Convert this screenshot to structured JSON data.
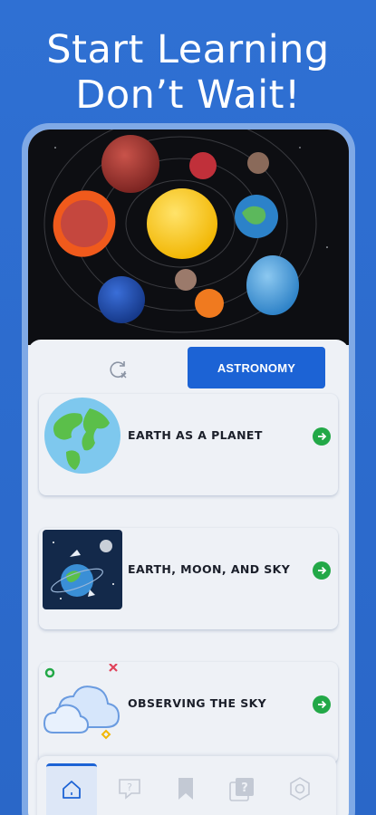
{
  "headline": {
    "line1": "Start Learning",
    "line2": "Don’t Wait!"
  },
  "hero": {
    "icon": "solar-system-image"
  },
  "toolbar": {
    "refresh_icon": "refresh-icon",
    "category_label": "ASTRONOMY"
  },
  "lessons": [
    {
      "title": "EARTH AS A PLANET",
      "icon": "earth-globe-icon"
    },
    {
      "title": "EARTH, MOON, AND SKY",
      "icon": "earth-moon-icon"
    },
    {
      "title": "OBSERVING THE SKY",
      "icon": "clouds-icon"
    }
  ],
  "nav": {
    "items": [
      {
        "icon": "home-icon",
        "active": true
      },
      {
        "icon": "quiz-bubble-icon",
        "active": false
      },
      {
        "icon": "bookmark-icon",
        "active": false
      },
      {
        "icon": "question-cards-icon",
        "active": false
      },
      {
        "icon": "settings-icon",
        "active": false
      }
    ]
  },
  "colors": {
    "background": "#2f70d3",
    "accent": "#1c63d5",
    "go_button": "#22a847"
  }
}
